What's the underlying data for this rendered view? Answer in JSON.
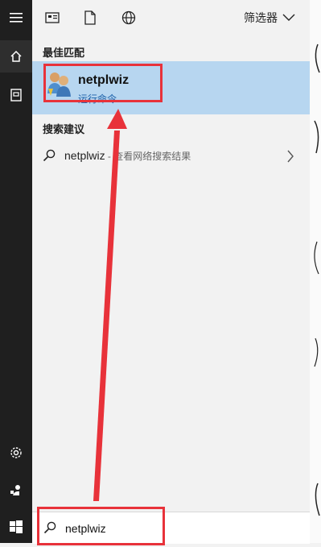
{
  "sidebar": {
    "menu_icon": "hamburger-icon",
    "home_icon": "home-icon",
    "documents_icon": "document-icon",
    "settings_icon": "gear-icon",
    "user_icon": "user-icon",
    "start_icon": "windows-icon"
  },
  "topbar": {
    "icons": [
      "apps-icon",
      "document-icon",
      "web-icon"
    ],
    "filter_label": "筛选器"
  },
  "best_match": {
    "heading": "最佳匹配",
    "title": "netplwiz",
    "subtitle": "运行命令",
    "icon": "user-accounts-icon"
  },
  "suggestions": {
    "heading": "搜索建议",
    "items": [
      {
        "term": "netplwiz",
        "suffix": " - 查看网络搜索结果"
      }
    ]
  },
  "search": {
    "value": "netplwiz"
  },
  "colors": {
    "highlight_border": "#e8323a",
    "selected_bg": "#b7d6f0",
    "sidebar_bg": "#1f1f1f"
  }
}
